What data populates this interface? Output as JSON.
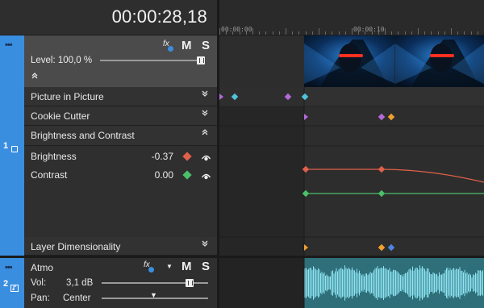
{
  "header": {
    "timecode": "00:00:28,18",
    "ruler": [
      "00:00:00",
      "00:00:10"
    ]
  },
  "track1": {
    "number": "1",
    "fx_label": "fx",
    "mute_label": "M",
    "solo_label": "S",
    "level_text": "Level: 100,0 %",
    "level_fraction": 1.0,
    "collapse_glyph": "^",
    "effects": [
      {
        "label": "Picture in Picture",
        "expanded": false
      },
      {
        "label": "Cookie Cutter",
        "expanded": false
      },
      {
        "label": "Brightness and Contrast",
        "expanded": true
      }
    ],
    "params": [
      {
        "label": "Brightness",
        "value": "-0.37",
        "color": "#e0604a"
      },
      {
        "label": "Contrast",
        "value": "0.00",
        "color": "#4cbf6a"
      }
    ],
    "bottom_effect": {
      "label": "Layer Dimensionality",
      "expanded": false
    }
  },
  "track2": {
    "number": "2",
    "name": "Atmo",
    "fx_label": "fx",
    "mute_label": "M",
    "solo_label": "S",
    "vol_label": "Vol:",
    "vol_value": "3,1 dB",
    "pan_label": "Pan:",
    "pan_value": "Center"
  },
  "colors": {
    "accent": "#3a8ee0",
    "brightness_curve": "#e0604a",
    "contrast_curve": "#4cbf6a",
    "waveform": "#4fc3d8",
    "keyframe_purple": "#b36ad8",
    "keyframe_cyan": "#4fc3d8",
    "keyframe_orange": "#f0a030",
    "keyframe_blue": "#4a86e0"
  }
}
